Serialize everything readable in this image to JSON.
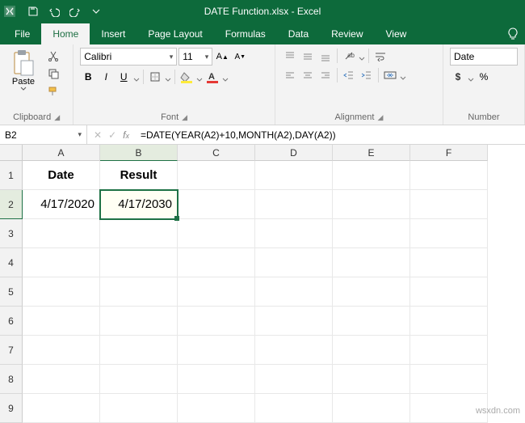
{
  "title": "DATE Function.xlsx - Excel",
  "tabs": [
    "File",
    "Home",
    "Insert",
    "Page Layout",
    "Formulas",
    "Data",
    "Review",
    "View"
  ],
  "active_tab": "Home",
  "clipboard": {
    "paste": "Paste",
    "label": "Clipboard"
  },
  "font": {
    "name": "Calibri",
    "size": "11",
    "label": "Font",
    "bold": "B",
    "italic": "I",
    "underline": "U"
  },
  "alignment": {
    "label": "Alignment"
  },
  "number": {
    "label": "Number",
    "format": "Date",
    "currency": "$"
  },
  "namebox": "B2",
  "formula": "=DATE(YEAR(A2)+10,MONTH(A2),DAY(A2))",
  "columns": [
    "A",
    "B",
    "C",
    "D",
    "E",
    "F"
  ],
  "rows": [
    "1",
    "2",
    "3",
    "4",
    "5",
    "6",
    "7",
    "8",
    "9"
  ],
  "cells": {
    "A1": "Date",
    "B1": "Result",
    "A2": "4/17/2020",
    "B2": "4/17/2030"
  },
  "watermark": "wsxdn.com",
  "colors": {
    "brand": "#0d6a3b",
    "accent": "#1e7145"
  },
  "chart_data": {
    "type": "table",
    "columns": [
      "Date",
      "Result"
    ],
    "rows": [
      [
        "4/17/2020",
        "4/17/2030"
      ]
    ]
  }
}
